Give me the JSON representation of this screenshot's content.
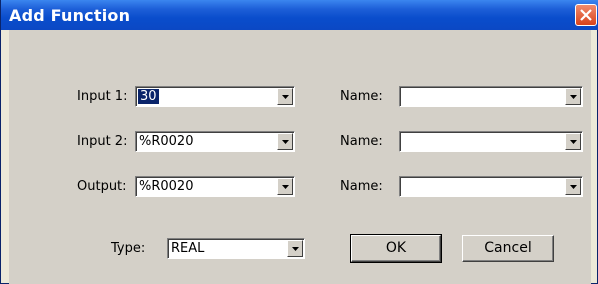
{
  "window": {
    "title": "Add Function"
  },
  "rows": [
    {
      "label": "Input 1:",
      "value": "30",
      "name_label": "Name:",
      "name_value": ""
    },
    {
      "label": "Input 2:",
      "value": "%R0020",
      "name_label": "Name:",
      "name_value": ""
    },
    {
      "label": "Output:",
      "value": "%R0020",
      "name_label": "Name:",
      "name_value": ""
    }
  ],
  "type": {
    "label": "Type:",
    "value": "REAL"
  },
  "buttons": {
    "ok": "OK",
    "cancel": "Cancel"
  },
  "colors": {
    "title_bar": "#0b48c4",
    "dialog_bg": "#d4d0c8",
    "close_button": "#d9431c"
  }
}
